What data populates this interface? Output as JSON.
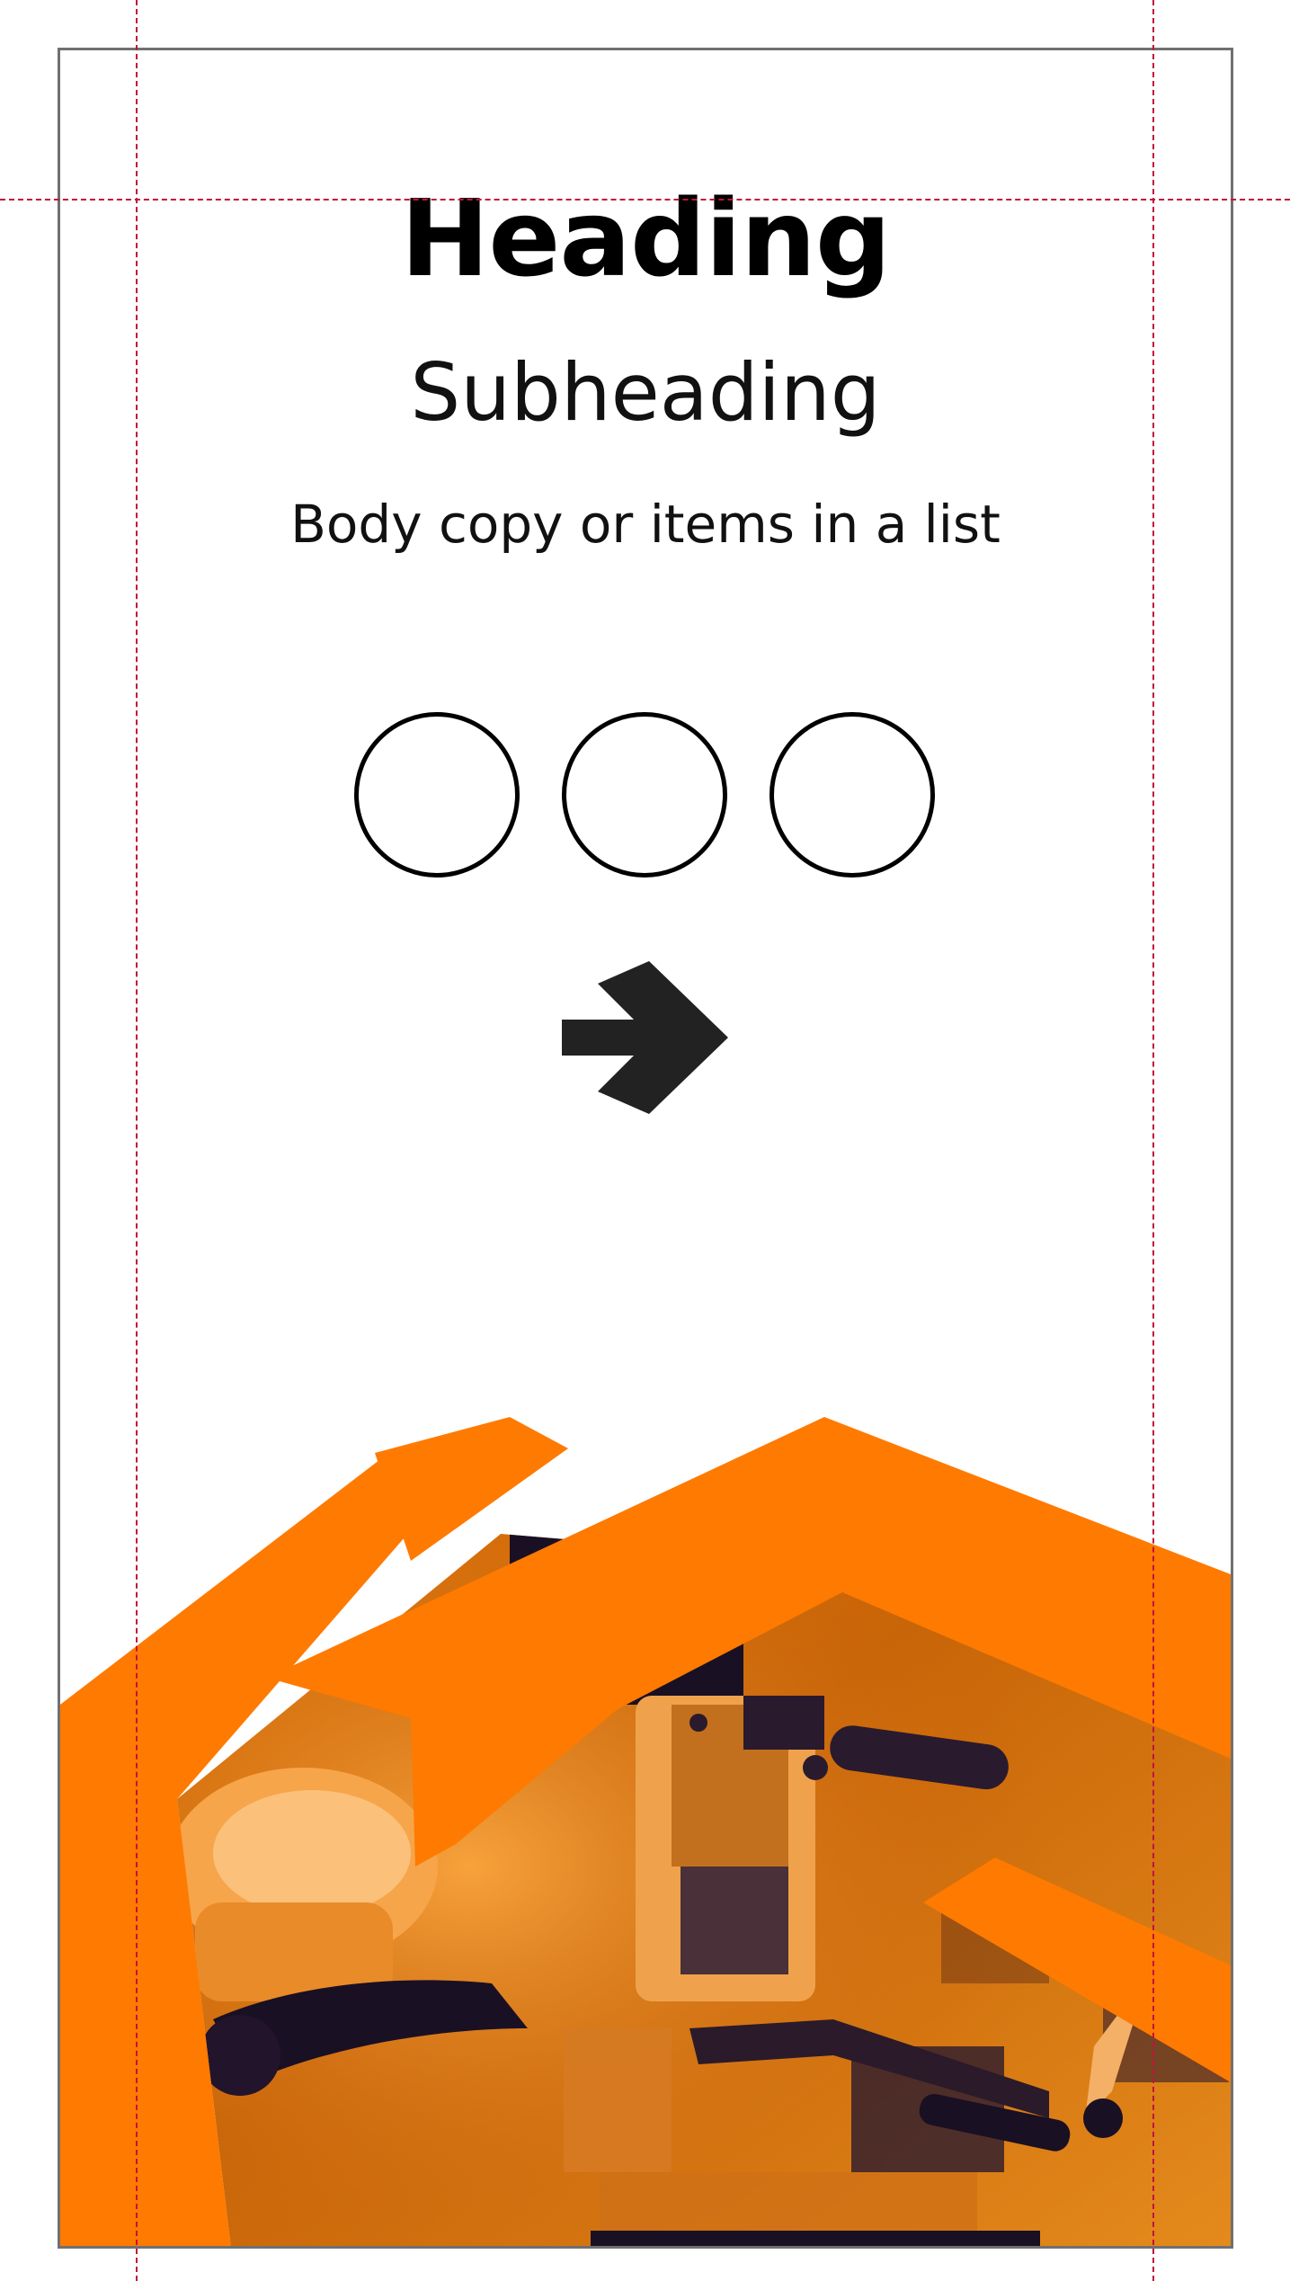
{
  "template": {
    "heading": "Heading",
    "subheading": "Subheading",
    "body_copy": "Body copy or items in a list"
  },
  "icons": {
    "placeholder_circles": [
      "circle-placeholder-icon",
      "circle-placeholder-icon",
      "circle-placeholder-icon"
    ],
    "arrow": "arrow-right-icon"
  },
  "colors": {
    "accent_orange": "#FF7A00",
    "dark_navy": "#1A1024",
    "guide_line": "#C0143C",
    "frame_border": "#707070"
  },
  "image": {
    "description_name": "robotic-arm-photo"
  }
}
